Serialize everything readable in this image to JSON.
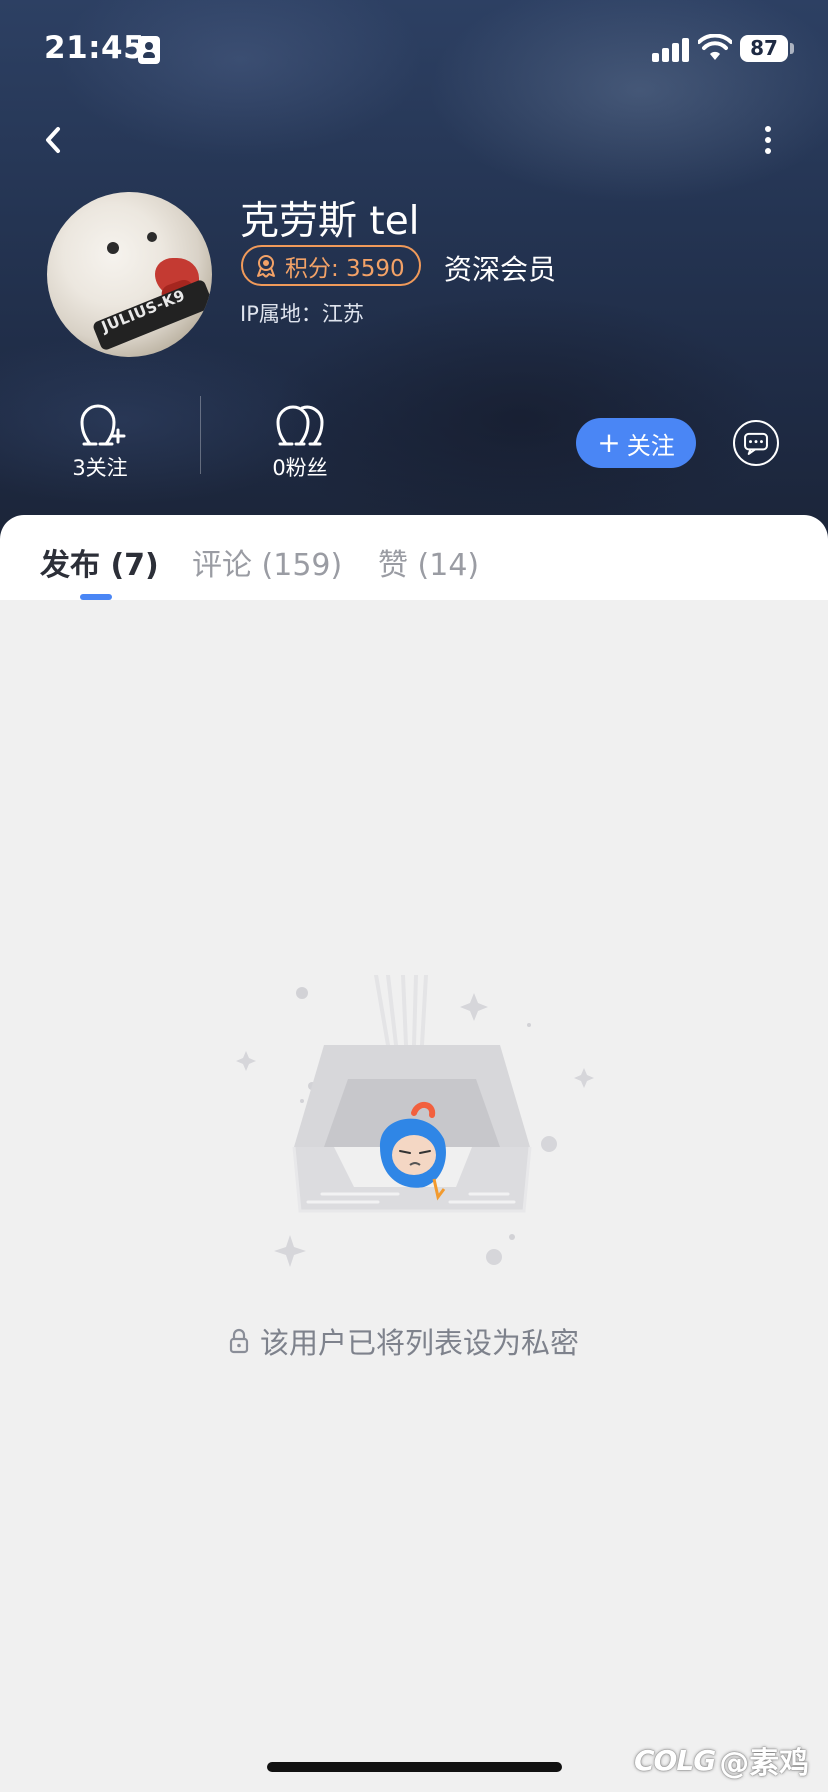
{
  "status_bar": {
    "time": "21:45",
    "battery": "87"
  },
  "profile": {
    "username": "克劳斯 tel",
    "points_label": "积分: 3590",
    "member_level": "资深会员",
    "ip_location": "IP属地：江苏",
    "avatar_harness_text": "JULIUS-K9"
  },
  "stats": {
    "following": "3关注",
    "followers": "0粉丝"
  },
  "actions": {
    "follow_label": "关注"
  },
  "tabs": [
    {
      "label": "发布 (7)",
      "active": true
    },
    {
      "label": "评论 (159)",
      "active": false
    },
    {
      "label": "赞 (14)",
      "active": false
    }
  ],
  "empty_state": {
    "message": "该用户已将列表设为私密"
  },
  "watermark": {
    "logo": "COLG",
    "handle": "@素鸡"
  },
  "colors": {
    "accent": "#4a86f5",
    "points": "#f3a267",
    "hero_bg": "#243452"
  }
}
